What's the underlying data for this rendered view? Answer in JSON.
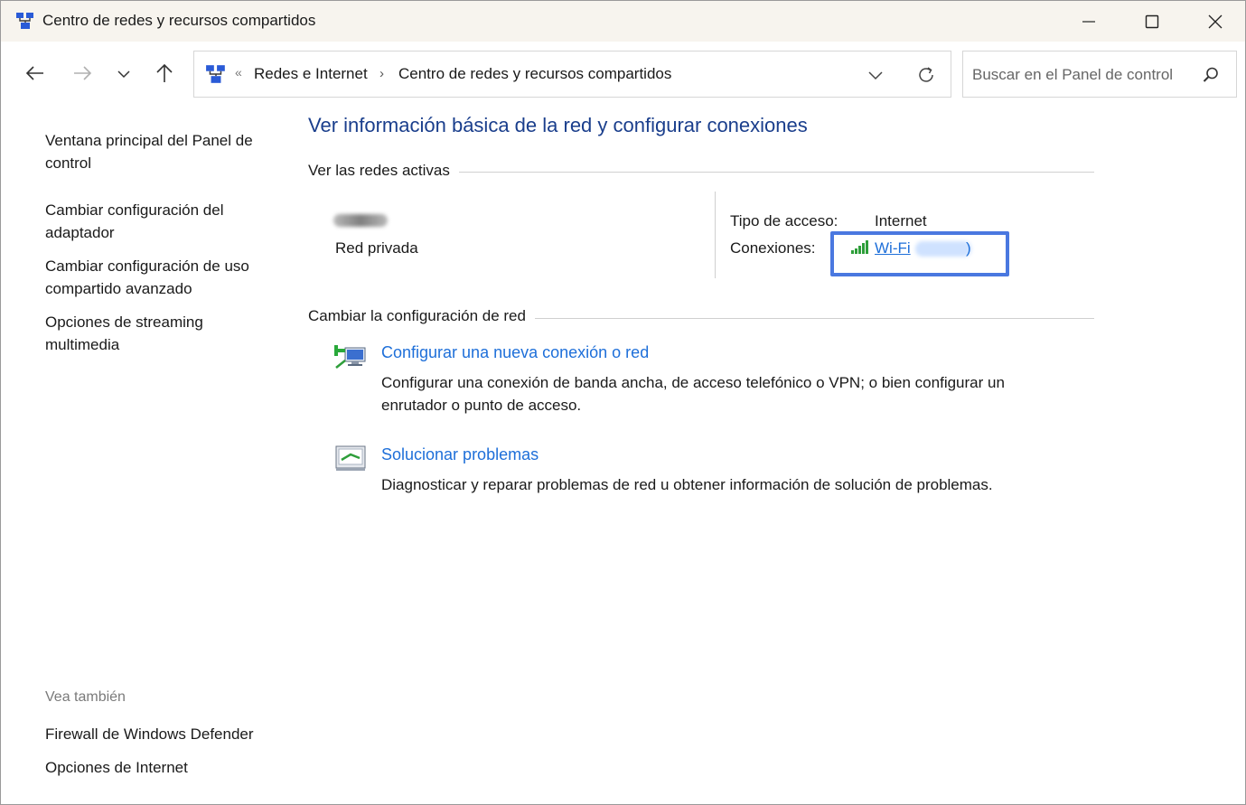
{
  "window": {
    "title": "Centro de redes y recursos compartidos",
    "icon": "network-center-icon"
  },
  "nav": {
    "back_icon": "arrow-left-icon",
    "forward_icon": "arrow-right-icon",
    "recent_icon": "chevron-down-icon",
    "up_icon": "arrow-up-icon"
  },
  "address": {
    "overflow": "«",
    "crumbs": [
      "Redes e Internet",
      "Centro de redes y recursos compartidos"
    ],
    "separator": "›"
  },
  "search": {
    "placeholder": "Buscar en el Panel de control"
  },
  "sidebar": {
    "links": [
      "Ventana principal del Panel de control",
      "Cambiar configuración del adaptador",
      "Cambiar configuración de uso compartido avanzado",
      "Opciones de streaming multimedia"
    ],
    "see_also_label": "Vea también",
    "see_also": [
      "Firewall de Windows Defender",
      "Opciones de Internet"
    ]
  },
  "main": {
    "heading": "Ver información básica de la red y configurar conexiones",
    "active_networks_label": "Ver las redes activas",
    "network": {
      "type": "Red privada",
      "access_label": "Tipo de acceso:",
      "access_value": "Internet",
      "connections_label": "Conexiones:",
      "connection_name": "Wi-Fi",
      "connection_suffix": ")"
    },
    "change_settings_label": "Cambiar la configuración de red",
    "tasks": [
      {
        "title": "Configurar una nueva conexión o red",
        "description": "Configurar una conexión de banda ancha, de acceso telefónico o VPN; o bien configurar un enrutador o punto de acceso.",
        "icon": "new-connection-icon"
      },
      {
        "title": "Solucionar problemas",
        "description": "Diagnosticar y reparar problemas de red u obtener información de solución de problemas.",
        "icon": "troubleshoot-icon"
      }
    ]
  },
  "colors": {
    "heading": "#1a3e8c",
    "link": "#1e6fd9",
    "highlight": "#4a78e0",
    "titlebar": "#f7f4ee"
  }
}
